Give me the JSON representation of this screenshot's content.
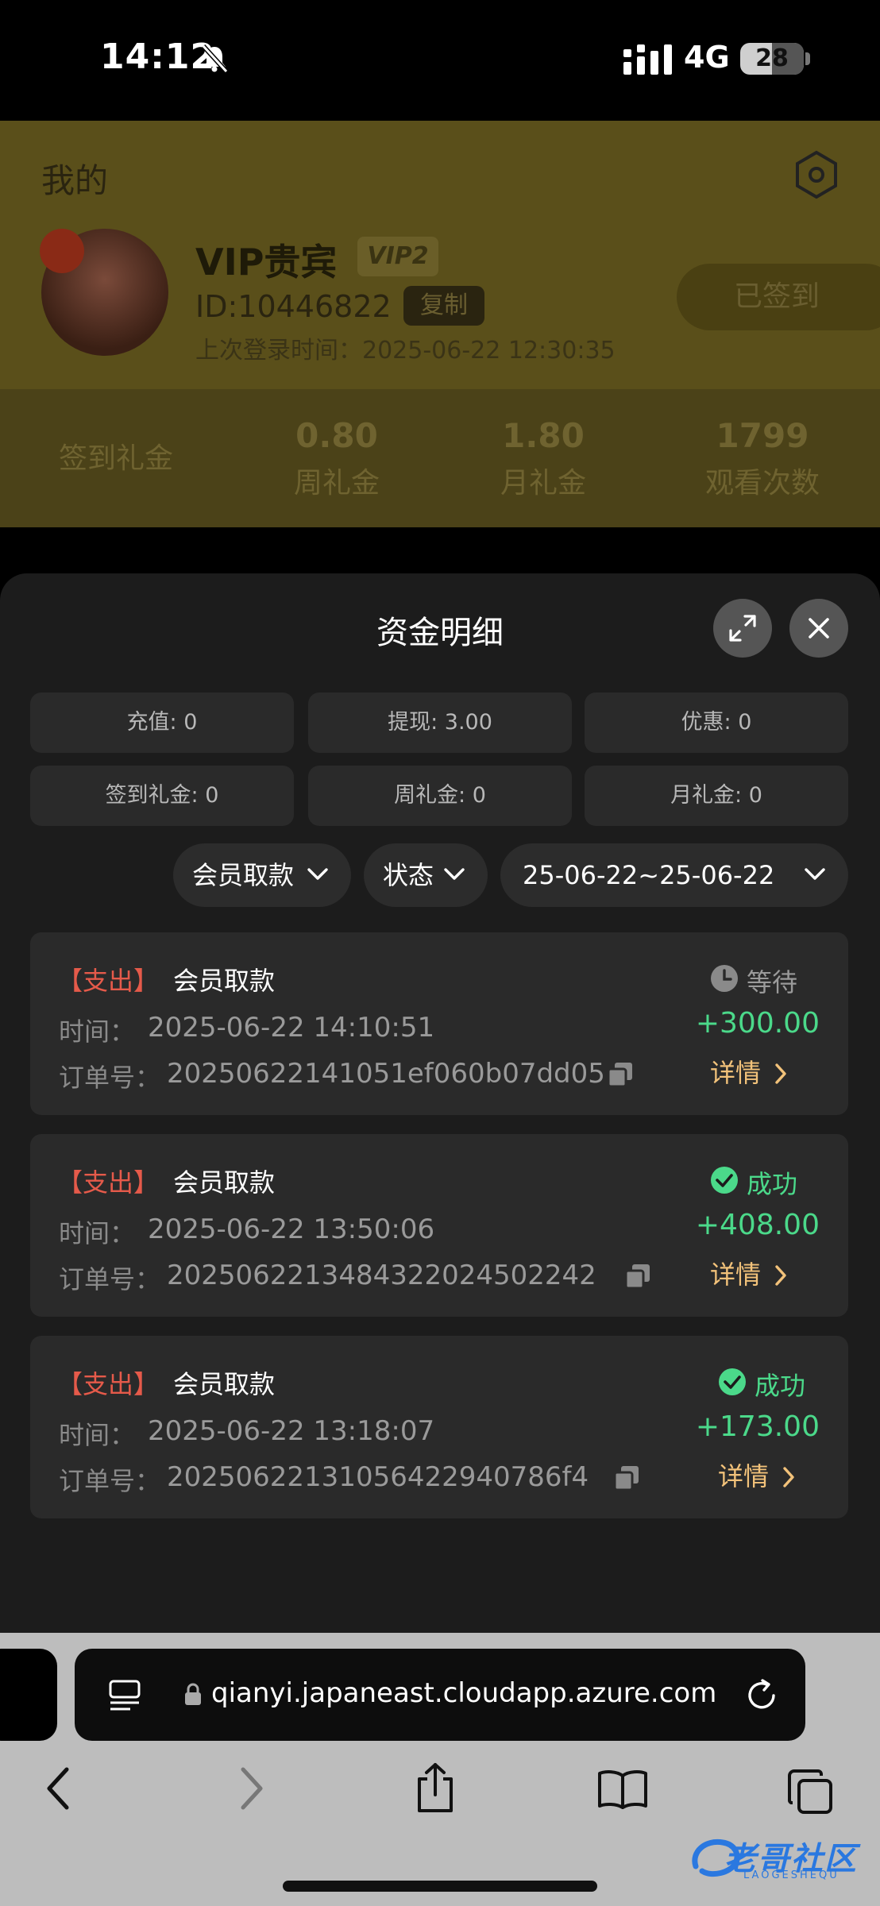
{
  "status_bar": {
    "time": "14:12",
    "network": "4G",
    "battery": "28"
  },
  "background_page": {
    "title": "我的",
    "user_name": "VIP贵宾",
    "vip_badge": "VIP2",
    "user_id": "ID:10446822",
    "copy_label": "复制",
    "last_login": "上次登录时间：2025-06-22 12:30:35",
    "signed_label": "已签到",
    "sign_gift_label": "签到礼金",
    "stats": [
      {
        "value": "0.80",
        "label": "周礼金"
      },
      {
        "value": "1.80",
        "label": "月礼金"
      },
      {
        "value": "1799",
        "label": "观看次数"
      }
    ]
  },
  "sheet": {
    "title": "资金明细",
    "summary": [
      "充值: 0",
      "提现: 3.00",
      "优惠: 0",
      "签到礼金: 0",
      "周礼金: 0",
      "月礼金: 0"
    ],
    "filters": {
      "type": "会员取款",
      "status": "状态",
      "date_range": "25-06-22~25-06-22"
    },
    "time_label": "时间：",
    "order_label": "订单号：",
    "detail_label": "详情",
    "records": [
      {
        "tag": "【支出】",
        "type": "会员取款",
        "time": "2025-06-22 14:10:51",
        "order": "20250622141051ef060b07dd05",
        "status": "等待",
        "amount": "+300.00"
      },
      {
        "tag": "【支出】",
        "type": "会员取款",
        "time": "2025-06-22 13:50:06",
        "order": "2025062213484322024502242",
        "status": "成功",
        "amount": "+408.00"
      },
      {
        "tag": "【支出】",
        "type": "会员取款",
        "time": "2025-06-22 13:18:07",
        "order": "20250622131056422940786f4",
        "status": "成功",
        "amount": "+173.00"
      }
    ]
  },
  "browser": {
    "url": "qianyi.japaneast.cloudapp.azure.com",
    "watermark": "老哥社区",
    "watermark_sub": "LAOGESHEQU"
  },
  "colors": {
    "accent_gold": "#f2c27a",
    "success_green": "#4bd98a",
    "expense_red": "#e55a4a",
    "sheet_bg": "#1c1c1c"
  }
}
